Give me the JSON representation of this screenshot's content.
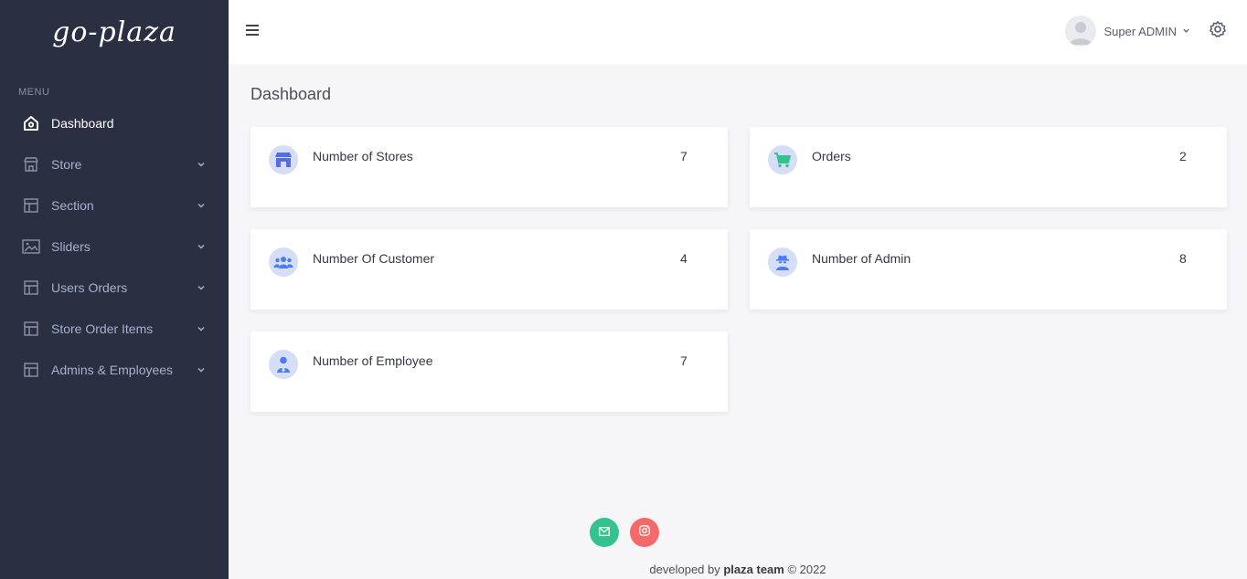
{
  "brand": {
    "name": "go-plaza"
  },
  "sidebar": {
    "menu_title": "MENU",
    "items": [
      {
        "label": "Dashboard",
        "icon": "home-icon"
      },
      {
        "label": "Store",
        "icon": "store-icon"
      },
      {
        "label": "Section",
        "icon": "layout-icon"
      },
      {
        "label": "Sliders",
        "icon": "image-icon"
      },
      {
        "label": "Users Orders",
        "icon": "layout-icon"
      },
      {
        "label": "Store Order Items",
        "icon": "layout-icon"
      },
      {
        "label": "Admins & Employees",
        "icon": "layout-icon"
      }
    ]
  },
  "topbar": {
    "user_name": "Super ADMIN"
  },
  "main": {
    "page_title": "Dashboard",
    "cards": [
      {
        "label": "Number of Stores",
        "value": "7",
        "icon": "store-icon"
      },
      {
        "label": "Orders",
        "value": "2",
        "icon": "cart-icon"
      },
      {
        "label": "Number Of Customer",
        "value": "4",
        "icon": "users-icon"
      },
      {
        "label": "Number of Admin",
        "value": "8",
        "icon": "user-secret-icon"
      },
      {
        "label": "Number of Employee",
        "value": "7",
        "icon": "user-tie-icon"
      }
    ]
  },
  "footer": {
    "prefix": "developed by ",
    "team": "plaza team",
    "suffix": " © 2022",
    "social": [
      {
        "icon": "email-icon",
        "color": "#34c38f"
      },
      {
        "icon": "instagram-icon",
        "color": "#f46a6a"
      }
    ]
  },
  "colors": {
    "sidebar_bg": "#2a3042",
    "accent": "#556ee6",
    "icon_bg": "#d6ddf6"
  }
}
